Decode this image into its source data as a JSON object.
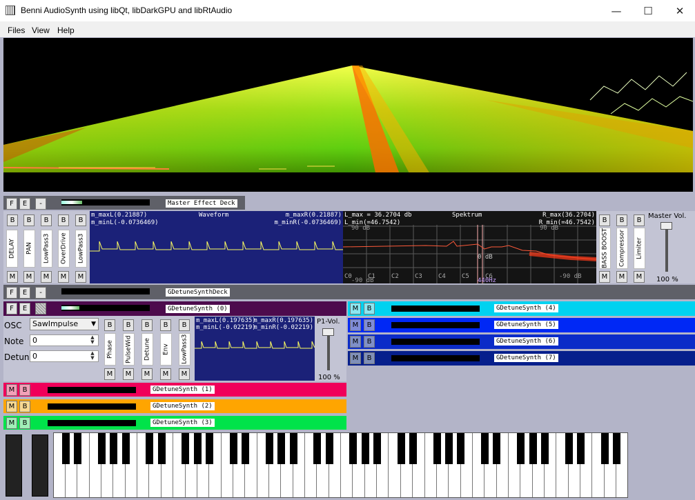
{
  "window": {
    "title": "Benni AudioSynth using libQt, libDarkGPU and libRtAudio",
    "min": "—",
    "max": "☐",
    "close": "✕"
  },
  "menu": [
    "Files",
    "View",
    "Help"
  ],
  "btn": {
    "f": "F",
    "e": "E",
    "b": "B",
    "m": "M",
    "dash": "-"
  },
  "master": {
    "deck_label": "Master Effect Deck",
    "effects": [
      "DELAY",
      "PAN",
      "LowPass3",
      "OverDrive",
      "LowPass3"
    ],
    "post": [
      "BASS BOOST",
      "Compressor",
      "Limiter"
    ],
    "vol_label": "Master Vol.",
    "vol_value": "100 %",
    "meter_level": 0.25
  },
  "waveform": {
    "title": "Waveform",
    "maxL": "m_maxL(0.21887)",
    "minL": "m_minL(-0.0736469)",
    "maxR": "m_maxR(0.21887)",
    "minR": "m_minR(-0.0736469)"
  },
  "spektrum": {
    "title": "Spektrum",
    "lmax": "L_max = 36.2704 db",
    "lmin": "L_min(=46.7542)",
    "rmax": "R_max(36.2704)",
    "rmin": "R_min(=46.7542)",
    "db_top_l": "90 dB",
    "db_top_r": "90 dB",
    "db_mid": "0 dB",
    "db_bot_l": "-90 dB",
    "db_bot_r": "-90 dB",
    "notes": [
      "C0",
      "C1",
      "C2",
      "C3",
      "C4",
      "C5",
      "C6"
    ],
    "marker": "440Hz"
  },
  "deck": {
    "label": "GDetuneSynthDeck"
  },
  "synth0": {
    "label": "GDetuneSynth (0)",
    "osc_label": "OSC",
    "osc_value": "SawImpulse",
    "note_label": "Note",
    "note_value": "0",
    "detune_label": "Detune",
    "detune_value": "0",
    "controls": [
      "Phase",
      "PulseWid",
      "Detune",
      "Env",
      "LowPass3"
    ],
    "maxL": "m_maxL(0.197635)",
    "maxR": "m_maxR(0.197635)",
    "minL": "m_minL(-0.02219)",
    "minR": "m_minR(-0.02219)",
    "vol_label": "P1-Vol.",
    "vol_value": "100 %"
  },
  "synths_left": [
    {
      "label": "GDetuneSynth (1)",
      "color": "#f0005a"
    },
    {
      "label": "GDetuneSynth (2)",
      "color": "#ffa500"
    },
    {
      "label": "GDetuneSynth (3)",
      "color": "#00e34a"
    }
  ],
  "synths_right": [
    {
      "label": "GDetuneSynth (4)",
      "color": "#00d2f0"
    },
    {
      "label": "GDetuneSynth (5)",
      "color": "#0028f5"
    },
    {
      "label": "GDetuneSynth (6)",
      "color": "#0b2bc8"
    },
    {
      "label": "GDetuneSynth (7)",
      "color": "#061f8c"
    }
  ]
}
